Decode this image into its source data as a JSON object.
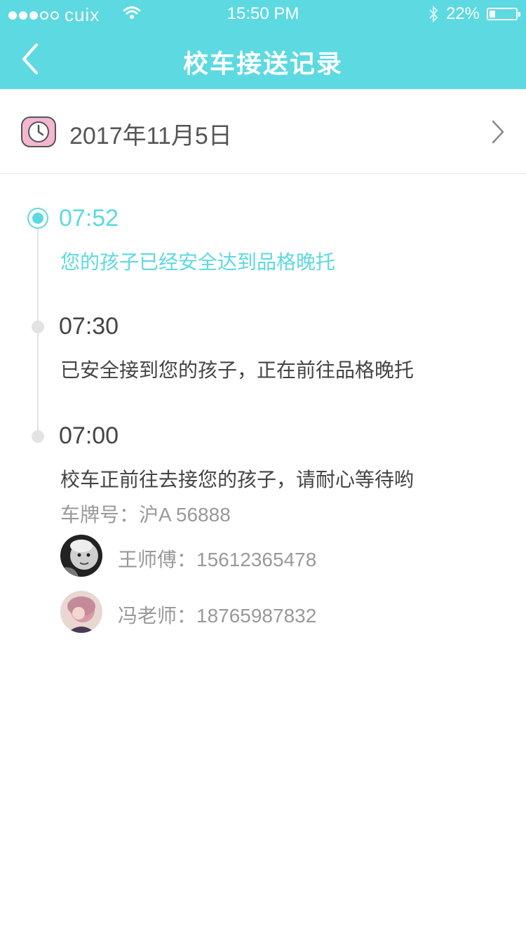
{
  "status_bar": {
    "carrier": "cuix",
    "time": "15:50 PM",
    "battery": "22%",
    "battery_level": 0.22,
    "signal_bars_filled": 3,
    "signal_bars_total": 5
  },
  "nav": {
    "back_icon": "chevron-left-icon",
    "title": "校车接送记录"
  },
  "date_selector": {
    "icon": "clock-icon",
    "date": "2017年11月5日",
    "chevron_icon": "chevron-right-icon"
  },
  "timeline": [
    {
      "time": "07:52",
      "message": "您的孩子已经安全达到品格晚托",
      "active": true
    },
    {
      "time": "07:30",
      "message": "已安全接到您的孩子，正在前往品格晚托",
      "active": false
    },
    {
      "time": "07:00",
      "message": "校车正前往去接您的孩子，请耐心等待哟",
      "active": false
    }
  ],
  "plate": "车牌号：沪A 56888",
  "contacts": [
    {
      "label": "王师傅：15612365478"
    },
    {
      "label": "冯老师：18765987832"
    }
  ],
  "colors": {
    "accent": "#5dd9e1",
    "text_dark": "#444444",
    "text_muted": "#999999",
    "clock_pink": "#f4b6d0"
  }
}
